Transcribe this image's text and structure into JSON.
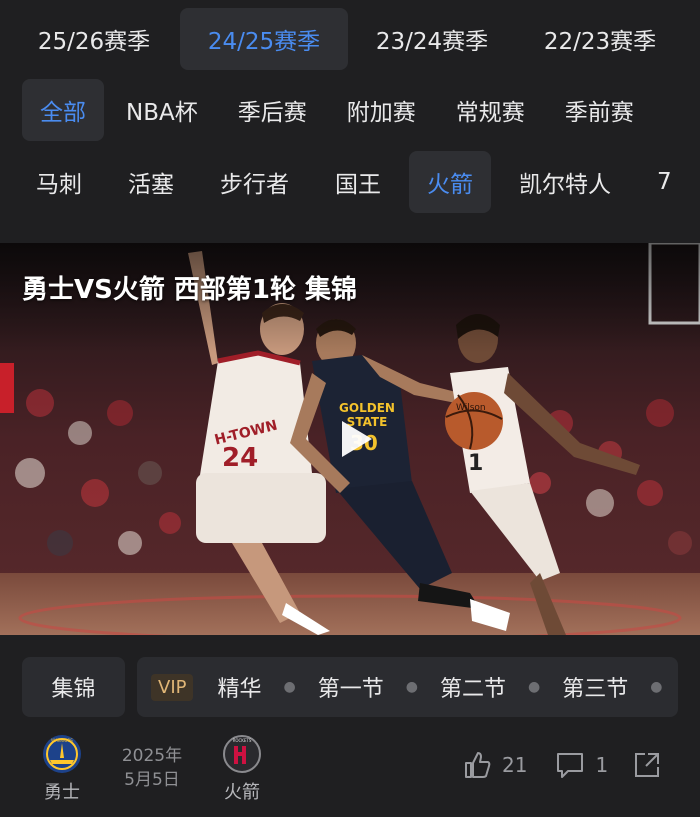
{
  "seasons": [
    {
      "label": "25/26赛季",
      "active": false
    },
    {
      "label": "24/25赛季",
      "active": true
    },
    {
      "label": "23/24赛季",
      "active": false
    },
    {
      "label": "22/23赛季",
      "active": false
    }
  ],
  "categories": [
    {
      "label": "全部",
      "active": true
    },
    {
      "label": "NBA杯",
      "active": false
    },
    {
      "label": "季后赛",
      "active": false
    },
    {
      "label": "附加赛",
      "active": false
    },
    {
      "label": "常规赛",
      "active": false
    },
    {
      "label": "季前赛",
      "active": false
    }
  ],
  "teams": [
    {
      "label": "马刺",
      "active": false
    },
    {
      "label": "活塞",
      "active": false
    },
    {
      "label": "步行者",
      "active": false
    },
    {
      "label": "国王",
      "active": false
    },
    {
      "label": "火箭",
      "active": true
    },
    {
      "label": "凯尔特人",
      "active": false
    },
    {
      "label": "7",
      "active": false
    }
  ],
  "video": {
    "title": "勇士VS火箭 西部第1轮 集锦",
    "jersey_left_text": "H-TOWN",
    "jersey_left_number": "24",
    "jersey_center_text": "GOLDEN STATE",
    "jersey_center_number": "30",
    "jersey_right_number": "1",
    "ball_text": "Wilson"
  },
  "tags": {
    "highlights": "集锦",
    "vip": "VIP",
    "items": [
      "精华",
      "第一节",
      "第二节",
      "第三节"
    ]
  },
  "match": {
    "home_team": "勇士",
    "home_logo_text": "WARRIORS",
    "date_year": "2025年",
    "date_day": "5月5日",
    "away_team": "火箭",
    "away_logo_text": "ROCKETS",
    "likes": "21",
    "comments": "1"
  },
  "colors": {
    "background": "#1f1f21",
    "accent": "#4a8cf0",
    "vip_gold": "#e0b677"
  }
}
